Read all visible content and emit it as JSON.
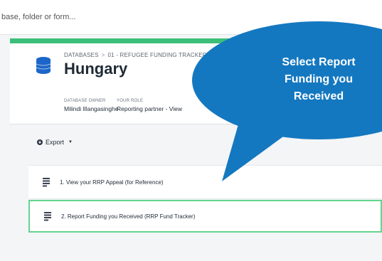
{
  "search": {
    "placeholder": "base, folder or form..."
  },
  "breadcrumb": {
    "root": "DATABASES",
    "separator": ">",
    "current": "01 - REFUGEE FUNDING TRACKER"
  },
  "page": {
    "title": "Hungary"
  },
  "meta": {
    "owner_label": "DATABASE OWNER",
    "owner_value": "Milindi Illangasinghe",
    "role_label": "YOUR ROLE",
    "role_value": "Reporting partner - View"
  },
  "toolbar": {
    "export_label": "Export"
  },
  "forms": [
    {
      "label": "1. View your RRP Appeal (for Reference)",
      "icon": "form-icon"
    },
    {
      "label": "2. Report Funding you Received (RRP Fund Tracker)",
      "icon": "form-icon",
      "selected": true
    }
  ],
  "callout": {
    "text": "Select Report\nFunding you\nReceived",
    "color": "#1478c0"
  },
  "colors": {
    "accent": "#3dbf7a",
    "highlight_border": "#63d58e",
    "db_icon": "#1c66c9"
  }
}
